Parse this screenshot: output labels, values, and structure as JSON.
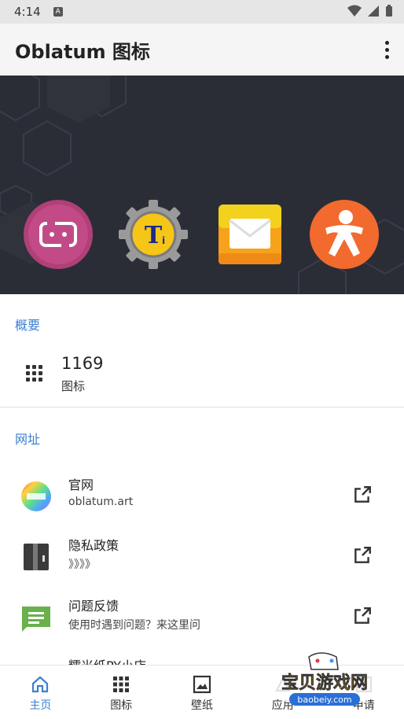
{
  "status_bar": {
    "time": "4:14"
  },
  "app_bar": {
    "title": "Oblatum 图标"
  },
  "overview": {
    "header": "概要",
    "count": "1169",
    "count_label": "图标"
  },
  "links": {
    "header": "网址",
    "items": [
      {
        "title": "官网",
        "subtitle": "oblatum.art"
      },
      {
        "title": "隐私政策",
        "subtitle": "》》》》"
      },
      {
        "title": "问题反馈",
        "subtitle": "使用时遇到问题？来这里问"
      },
      {
        "title": "糯米纸PY小店",
        "subtitle": ""
      }
    ]
  },
  "bottom_nav": [
    {
      "label": "主页",
      "active": true
    },
    {
      "label": "图标",
      "active": false
    },
    {
      "label": "壁纸",
      "active": false
    },
    {
      "label": "应用",
      "active": false
    },
    {
      "label": "申请",
      "active": false
    }
  ],
  "watermark": {
    "text": "宝贝游戏网",
    "url": "baobeiy.com"
  },
  "colors": {
    "accent": "#3b7fd4",
    "banner_bg": "#2b2d36"
  }
}
